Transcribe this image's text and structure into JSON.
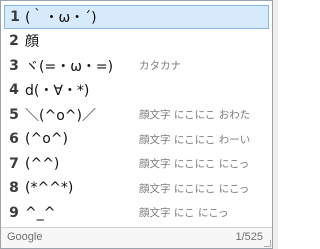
{
  "candidates": [
    {
      "number": "1",
      "text": "(｀・ω・´)",
      "annotation": ""
    },
    {
      "number": "2",
      "text": "顔",
      "annotation": ""
    },
    {
      "number": "3",
      "text": "ヾ(=・ω・=)",
      "annotation": "カタカナ"
    },
    {
      "number": "4",
      "text": "d(・∀・*)",
      "annotation": ""
    },
    {
      "number": "5",
      "text": "＼(^o^)／",
      "annotation": "顔文字 にこにこ おわた"
    },
    {
      "number": "6",
      "text": "(^o^)",
      "annotation": "顔文字 にこにこ わーい"
    },
    {
      "number": "7",
      "text": "(^^)",
      "annotation": "顔文字 にこにこ にこっ"
    },
    {
      "number": "8",
      "text": "(*^^*)",
      "annotation": "顔文字 にこにこ にこっ"
    },
    {
      "number": "9",
      "text": "^_^",
      "annotation": "顔文字 にこ にこっ"
    }
  ],
  "selected_index": 0,
  "footer": {
    "brand": "Google",
    "page_indicator": "1/525"
  },
  "colors": {
    "selection_bg": "#d6eafb",
    "selection_border": "#84b6e6",
    "annotation": "#7c7c7c"
  }
}
